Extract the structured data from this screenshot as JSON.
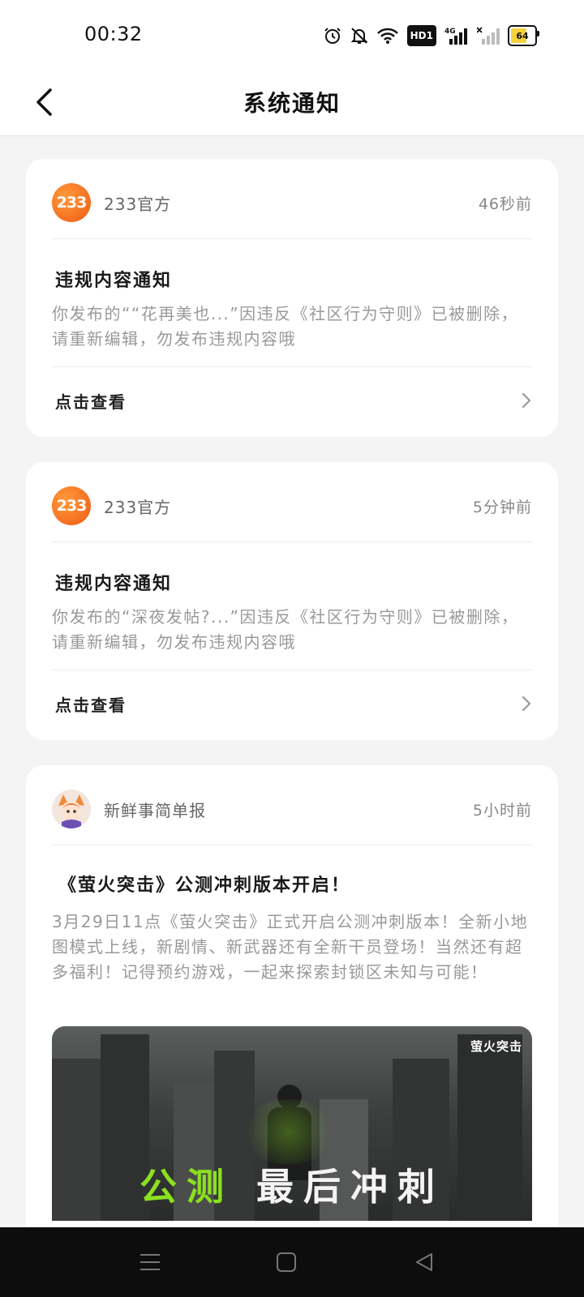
{
  "status_bar": {
    "time": "00:32",
    "icons": [
      "alarm-icon",
      "bell-off-icon",
      "wifi-icon",
      "hd-badge",
      "signal-4g-icon",
      "signal-no-icon",
      "battery-icon"
    ],
    "hd_label": "HD1",
    "network_label": "4G",
    "battery_level": "64"
  },
  "header": {
    "title": "系统通知",
    "back_icon": "chevron-left-icon"
  },
  "notifications": [
    {
      "sender": "233官方",
      "avatar_text": "233",
      "time": "46秒前",
      "title": "违规内容通知",
      "body": "你发布的““花再美也...”因违反《社区行为守则》已被删除，请重新编辑，勿发布违规内容哦",
      "action_label": "点击查看"
    },
    {
      "sender": "233官方",
      "avatar_text": "233",
      "time": "5分钟前",
      "title": "违规内容通知",
      "body": "你发布的“深夜发帖?...”因违反《社区行为守则》已被删除，请重新编辑，勿发布违规内容哦",
      "action_label": "点击查看"
    },
    {
      "sender": "新鲜事简单报",
      "time": "5小时前",
      "title": "《萤火突击》公测冲刺版本开启！",
      "body": "3月29日11点《萤火突击》正式开启公测冲刺版本！全新小地图模式上线，新剧情、新武器还有全新干员登场！当然还有超多福利！记得预约游戏，一起来探索封锁区未知与可能！",
      "banner": {
        "logo": "萤火突击",
        "text_green": "公测",
        "text_white": "最后冲刺"
      }
    }
  ],
  "colors": {
    "accent_orange": "#f05a14",
    "banner_green": "#8be01f",
    "page_bg": "#f4f4f4"
  },
  "system_nav": [
    "menu-icon",
    "home-icon",
    "back-icon"
  ]
}
